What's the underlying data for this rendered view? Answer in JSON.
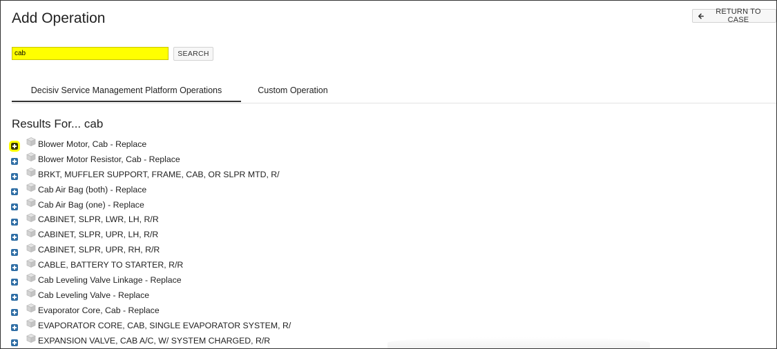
{
  "page": {
    "title": "Add Operation",
    "return_label": "RETURN TO CASE"
  },
  "search": {
    "value": "cab",
    "button_label": "SEARCH",
    "highlight_color": "#ffff00"
  },
  "tabs": [
    {
      "label": "Decisiv Service Management Platform Operations",
      "active": true
    },
    {
      "label": "Custom Operation",
      "active": false
    }
  ],
  "results": {
    "heading": "Results For... cab",
    "expand_icon": "plus-square-icon",
    "item_icon": "cube-icon",
    "items": [
      {
        "label": "Blower Motor, Cab - Replace"
      },
      {
        "label": "Blower Motor Resistor, Cab - Replace"
      },
      {
        "label": "BRKT, MUFFLER SUPPORT, FRAME, CAB, OR SLPR MTD, R/"
      },
      {
        "label": "Cab Air Bag (both) - Replace"
      },
      {
        "label": "Cab Air Bag (one) - Replace"
      },
      {
        "label": "CABINET, SLPR, LWR, LH, R/R"
      },
      {
        "label": "CABINET, SLPR, UPR, LH, R/R"
      },
      {
        "label": "CABINET, SLPR, UPR, RH, R/R"
      },
      {
        "label": "CABLE, BATTERY TO STARTER, R/R"
      },
      {
        "label": "Cab Leveling Valve Linkage - Replace"
      },
      {
        "label": "Cab Leveling Valve - Replace"
      },
      {
        "label": "Evaporator Core, Cab - Replace"
      },
      {
        "label": "EVAPORATOR CORE, CAB, SINGLE EVAPORATOR SYSTEM, R/"
      },
      {
        "label": "EXPANSION VALVE, CAB A/C, W/ SYSTEM CHARGED, R/R"
      }
    ]
  },
  "colors": {
    "expand_icon": "#2f6ea5",
    "text": "#222222",
    "tab_underline": "#333333"
  }
}
